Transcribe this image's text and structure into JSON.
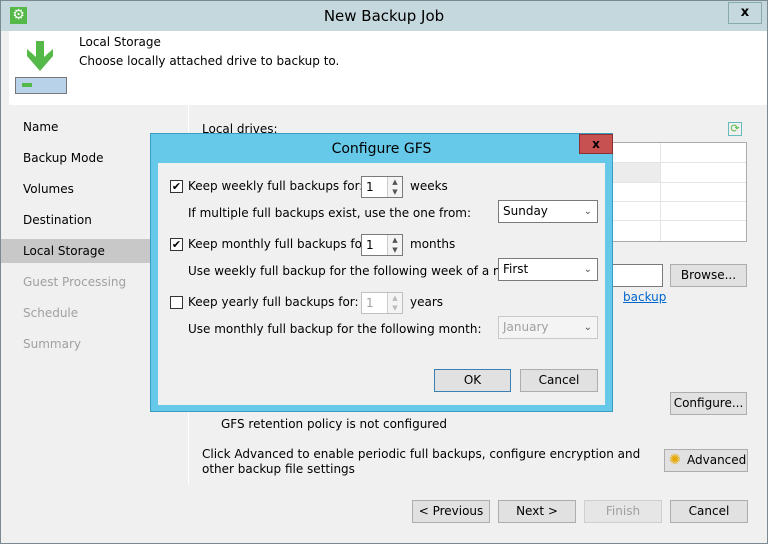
{
  "window": {
    "title": "New Backup Job",
    "close": "x"
  },
  "header": {
    "title": "Local Storage",
    "subtitle": "Choose locally attached drive to backup to."
  },
  "nav": [
    {
      "label": "Name",
      "state": "normal"
    },
    {
      "label": "Backup Mode",
      "state": "normal"
    },
    {
      "label": "Volumes",
      "state": "normal"
    },
    {
      "label": "Destination",
      "state": "normal"
    },
    {
      "label": "Local Storage",
      "state": "active"
    },
    {
      "label": "Guest Processing",
      "state": "disabled"
    },
    {
      "label": "Schedule",
      "state": "disabled"
    },
    {
      "label": "Summary",
      "state": "disabled"
    }
  ],
  "main": {
    "local_drives_label": "Local drives:",
    "browse": "Browse...",
    "link_text": "backup",
    "configure": "Configure...",
    "gfs_status": "GFS retention policy is not configured",
    "advanced_text": "Click Advanced to enable periodic full backups, configure encryption and other backup file settings",
    "advanced": "Advanced"
  },
  "footer": {
    "previous": "< Previous",
    "next": "Next >",
    "finish": "Finish",
    "cancel": "Cancel"
  },
  "dialog": {
    "title": "Configure GFS",
    "close": "x",
    "weekly": {
      "checked": true,
      "label": "Keep weekly full backups for:",
      "value": "1",
      "unit": "weeks",
      "sub_label": "If multiple full backups exist, use the one from:",
      "select": "Sunday"
    },
    "monthly": {
      "checked": true,
      "label": "Keep monthly full backups for:",
      "value": "1",
      "unit": "months",
      "sub_label": "Use weekly full backup for the following week of a month:",
      "select": "First"
    },
    "yearly": {
      "checked": false,
      "label": "Keep yearly full backups for:",
      "value": "1",
      "unit": "years",
      "sub_label": "Use monthly full backup for the following month:",
      "select": "January"
    },
    "ok": "OK",
    "cancel": "Cancel"
  },
  "colors": {
    "titlebar": "#c5d8de",
    "dialog_title": "#67c9ea",
    "close_red": "#c75050",
    "accent_green": "#54b948"
  }
}
